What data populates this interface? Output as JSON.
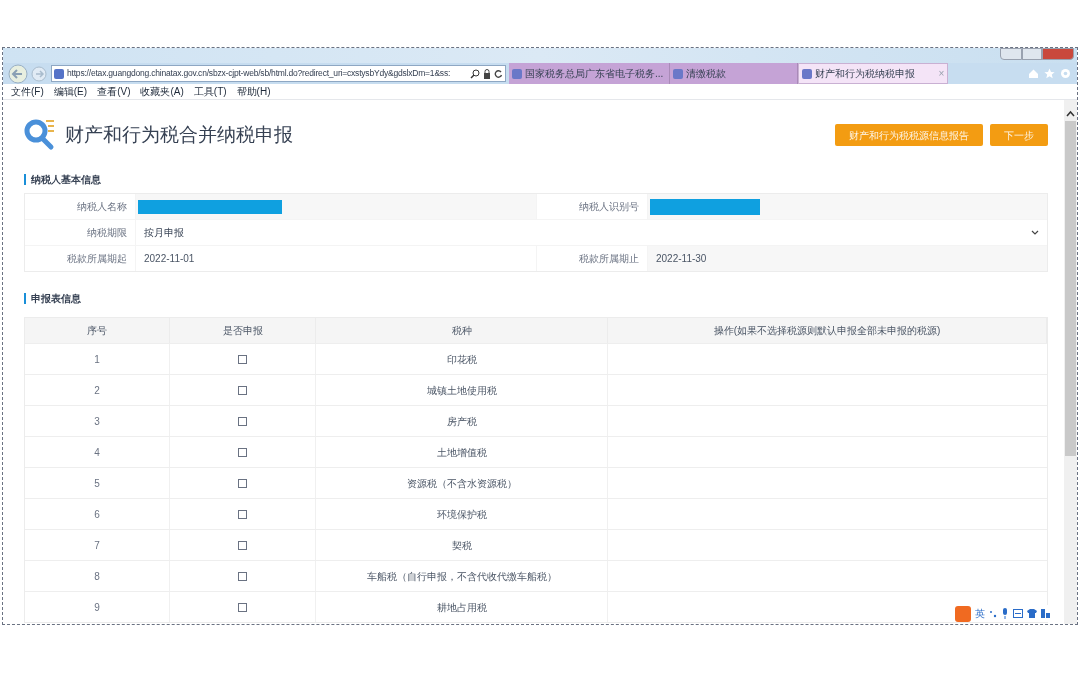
{
  "browser": {
    "url": "https://etax.guangdong.chinatax.gov.cn/sbzx-cjpt-web/sb/html.do?redirect_uri=cxstysbYdy&gdslxDm=1&ss:",
    "tabs": [
      {
        "label": "国家税务总局广东省电子税务...",
        "selected": false
      },
      {
        "label": "清缴税款",
        "selected": false
      },
      {
        "label": "财产和行为税纳税申报",
        "selected": true,
        "close": "×"
      }
    ],
    "menu": [
      "文件(F)",
      "编辑(E)",
      "查看(V)",
      "收藏夹(A)",
      "工具(T)",
      "帮助(H)"
    ]
  },
  "page": {
    "title": "财产和行为税合并纳税申报",
    "buttons": [
      "财产和行为税税源信息报告",
      "下一步"
    ],
    "basic_info": {
      "heading": "纳税人基本信息",
      "rows": [
        [
          {
            "label": "纳税人名称",
            "kind": "redacted"
          },
          {
            "label": "纳税人识别号",
            "kind": "redacted"
          }
        ],
        [
          {
            "label": "纳税期限",
            "kind": "select",
            "value": "按月申报"
          }
        ],
        [
          {
            "label": "税款所属期起",
            "kind": "text",
            "value": "2022-11-01"
          },
          {
            "label": "税款所属期止",
            "kind": "readonly",
            "value": "2022-11-30"
          }
        ]
      ]
    },
    "declaration": {
      "heading": "申报表信息",
      "columns": [
        "序号",
        "是否申报",
        "税种",
        "操作(如果不选择税源则默认申报全部未申报的税源)"
      ],
      "rows": [
        {
          "no": "1",
          "checked": false,
          "tax": "印花税"
        },
        {
          "no": "2",
          "checked": false,
          "tax": "城镇土地使用税"
        },
        {
          "no": "3",
          "checked": false,
          "tax": "房产税"
        },
        {
          "no": "4",
          "checked": false,
          "tax": "土地增值税"
        },
        {
          "no": "5",
          "checked": false,
          "tax": "资源税（不含水资源税）"
        },
        {
          "no": "6",
          "checked": false,
          "tax": "环境保护税"
        },
        {
          "no": "7",
          "checked": false,
          "tax": "契税"
        },
        {
          "no": "8",
          "checked": false,
          "tax": "车船税（自行申报，不含代收代缴车船税）"
        },
        {
          "no": "9",
          "checked": false,
          "tax": "耕地占用税"
        }
      ]
    }
  },
  "ime_bar": {
    "mode": "英"
  }
}
